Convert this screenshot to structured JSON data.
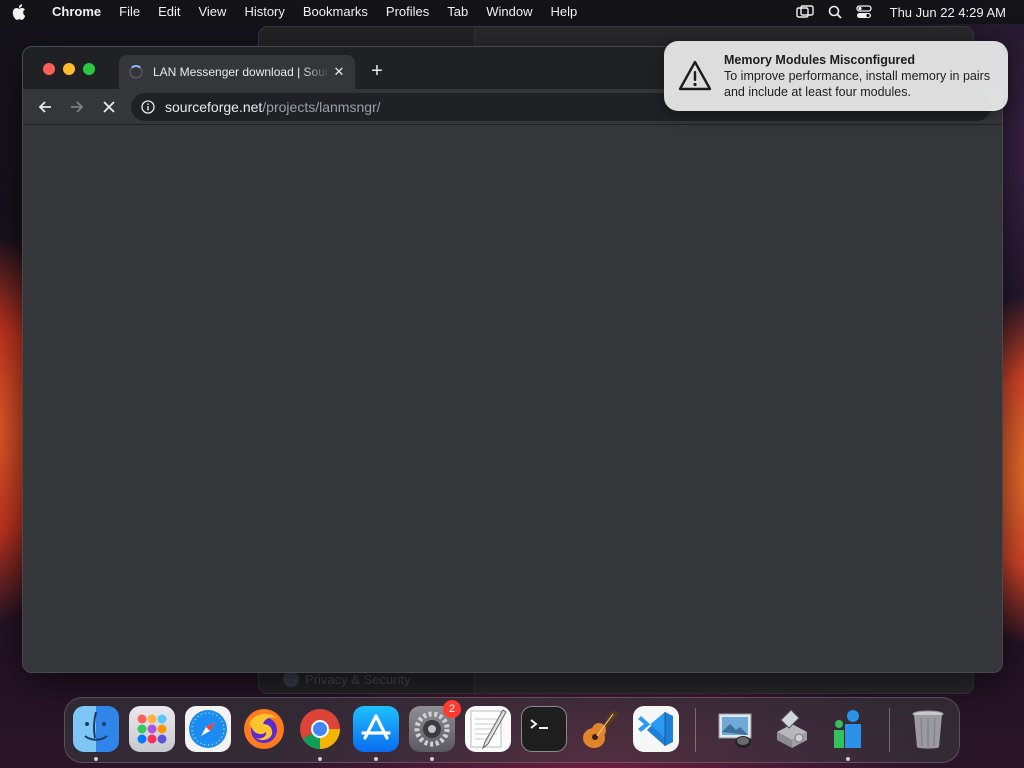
{
  "menubar": {
    "app_name": "Chrome",
    "menus": [
      "File",
      "Edit",
      "View",
      "History",
      "Bookmarks",
      "Profiles",
      "Tab",
      "Window",
      "Help"
    ],
    "clock": "Thu Jun 22  4:29 AM"
  },
  "browser": {
    "tab_title": "LAN Messenger download | SourceForge",
    "omnibox": {
      "host": "sourceforge.net",
      "path": "/projects/lanmsngr/"
    }
  },
  "background_window": {
    "ghost_label": "Privacy & Security"
  },
  "notification": {
    "title": "Memory Modules Misconfigured",
    "body": "To improve performance, install memory in pairs and include at least four modules."
  },
  "dock": {
    "items": [
      {
        "name": "finder-icon",
        "running": true
      },
      {
        "name": "launchpad-icon",
        "running": false
      },
      {
        "name": "safari-icon",
        "running": false
      },
      {
        "name": "firefox-icon",
        "running": false
      },
      {
        "name": "chrome-icon",
        "running": true
      },
      {
        "name": "app-store-icon",
        "running": true
      },
      {
        "name": "system-settings-icon",
        "running": true,
        "badge": "2"
      },
      {
        "name": "textedit-icon",
        "running": false
      },
      {
        "name": "terminal-icon",
        "running": false
      },
      {
        "name": "garageband-icon",
        "running": false
      },
      {
        "name": "vscode-icon",
        "running": false
      },
      {
        "name": "preview-icon",
        "running": false
      },
      {
        "name": "disk-utility-icon",
        "running": false
      },
      {
        "name": "people-icon",
        "running": true
      },
      {
        "name": "trash-icon",
        "running": false
      }
    ]
  }
}
